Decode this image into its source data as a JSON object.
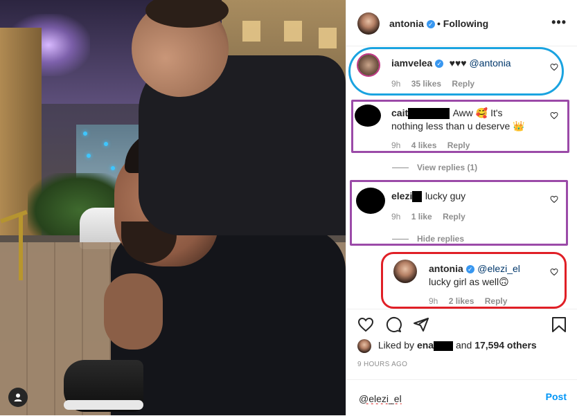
{
  "header": {
    "username": "antonia",
    "separator": "•",
    "follow_label": "Following",
    "more": "•••"
  },
  "comments": [
    {
      "user": "iamvelea",
      "text_parts": [
        "♥♥♥ ",
        "@antonia"
      ],
      "time": "9h",
      "likes": "35 likes",
      "reply": "Reply"
    },
    {
      "user": "cait",
      "text": "Aww 🥰 It's nothing less than u deserve 👑",
      "time": "9h",
      "likes": "4 likes",
      "reply": "Reply"
    },
    {
      "user": "elezi",
      "text": "lucky guy",
      "time": "9h",
      "likes": "1 like",
      "reply": "Reply"
    },
    {
      "user": "antonia",
      "mention": "@elezi_el",
      "text": "lucky girl as well🙃",
      "time": "9h",
      "likes": "2 likes",
      "reply": "Reply"
    }
  ],
  "view_replies": "View replies (1)",
  "hide_replies": "Hide replies",
  "likes_line": {
    "prefix": "Liked by ",
    "user": "ena",
    "mid": " and ",
    "count": "17,594 others"
  },
  "timestamp": "9 HOURS AGO",
  "composer": {
    "value": "@elezi_el",
    "post_label": "Post"
  },
  "colors": {
    "link": "#00376b",
    "post": "#0095f6",
    "verified": "#3897f0",
    "annot_blue": "#1aa3e0",
    "annot_purple": "#9b4aa8",
    "annot_red": "#e01f26"
  }
}
